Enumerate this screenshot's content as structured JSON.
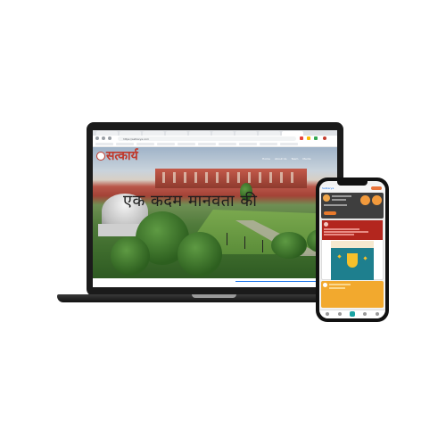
{
  "laptop": {
    "logo_text": "सत्कार्य",
    "address": "https://satkarya.com",
    "hero_text": "एक कदम मानवता की",
    "nav": [
      "Home",
      "About Us",
      "Team",
      "Media"
    ]
  },
  "phone": {
    "caption": "Satkarya"
  },
  "colors": {
    "brand_red": "#c0392b",
    "accent_orange": "#e87a2c",
    "card_red": "#b3261e",
    "card_yellow": "#f2a92e"
  }
}
